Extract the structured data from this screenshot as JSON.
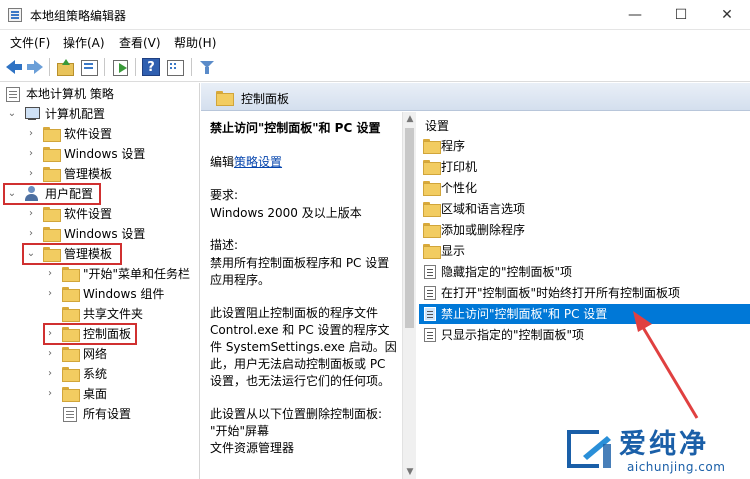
{
  "window": {
    "title": "本地组策略编辑器",
    "controls": {
      "minimize": "—",
      "maximize": "☐",
      "close": "✕"
    }
  },
  "menu": [
    {
      "label": "文件(F)"
    },
    {
      "label": "操作(A)"
    },
    {
      "label": "查看(V)"
    },
    {
      "label": "帮助(H)"
    }
  ],
  "toolbar": {
    "help": "?"
  },
  "tree": {
    "root": "本地计算机 策略",
    "computer_config": "计算机配置",
    "cc_software": "软件设置",
    "cc_windows": "Windows 设置",
    "cc_admin": "管理模板",
    "user_config": "用户配置",
    "uc_software": "软件设置",
    "uc_windows": "Windows 设置",
    "uc_admin": "管理模板",
    "start_menu": "\"开始\"菜单和任务栏",
    "windows_components": "Windows 组件",
    "shared_folders": "共享文件夹",
    "control_panel": "控制面板",
    "network": "网络",
    "system": "系统",
    "desktop": "桌面",
    "all_settings": "所有设置"
  },
  "right": {
    "header": "控制面板",
    "desc": {
      "title": "禁止访问\"控制面板\"和 PC 设置",
      "edit_prefix": "编辑",
      "edit_link": "策略设置",
      "req_label": "要求:",
      "req_value": "Windows 2000 及以上版本",
      "desc_label": "描述:",
      "desc_line1": "禁用所有控制面板程序和 PC 设置",
      "desc_line2": "应用程序。",
      "p1_line1": "此设置阻止控制面板的程序文件",
      "p1_line2": "Control.exe 和 PC 设置的程序文",
      "p1_line3": "件 SystemSettings.exe 启动。因",
      "p1_line4": "此，用户无法启动控制面板或 PC",
      "p1_line5": "设置，也无法运行它们的任何项。",
      "p2_line1": "此设置从以下位置删除控制面板:",
      "p2_line2": "\"开始\"屏幕",
      "p2_line3": "文件资源管理器"
    },
    "settings": {
      "column": "设置",
      "items": [
        {
          "label": "程序",
          "type": "folder"
        },
        {
          "label": "打印机",
          "type": "folder"
        },
        {
          "label": "个性化",
          "type": "folder"
        },
        {
          "label": "区域和语言选项",
          "type": "folder"
        },
        {
          "label": "添加或删除程序",
          "type": "folder"
        },
        {
          "label": "显示",
          "type": "folder"
        },
        {
          "label": "隐藏指定的\"控制面板\"项",
          "type": "setting"
        },
        {
          "label": "在打开\"控制面板\"时始终打开所有控制面板项",
          "type": "setting"
        },
        {
          "label": "禁止访问\"控制面板\"和 PC 设置",
          "type": "setting",
          "selected": true
        },
        {
          "label": "只显示指定的\"控制面板\"项",
          "type": "setting"
        }
      ]
    }
  },
  "watermark": {
    "text": "爱纯净",
    "url": "aichunjing.com"
  },
  "colors": {
    "selection": "#0078d7",
    "highlight_box": "#d03030",
    "folder": "#f2cc61"
  }
}
